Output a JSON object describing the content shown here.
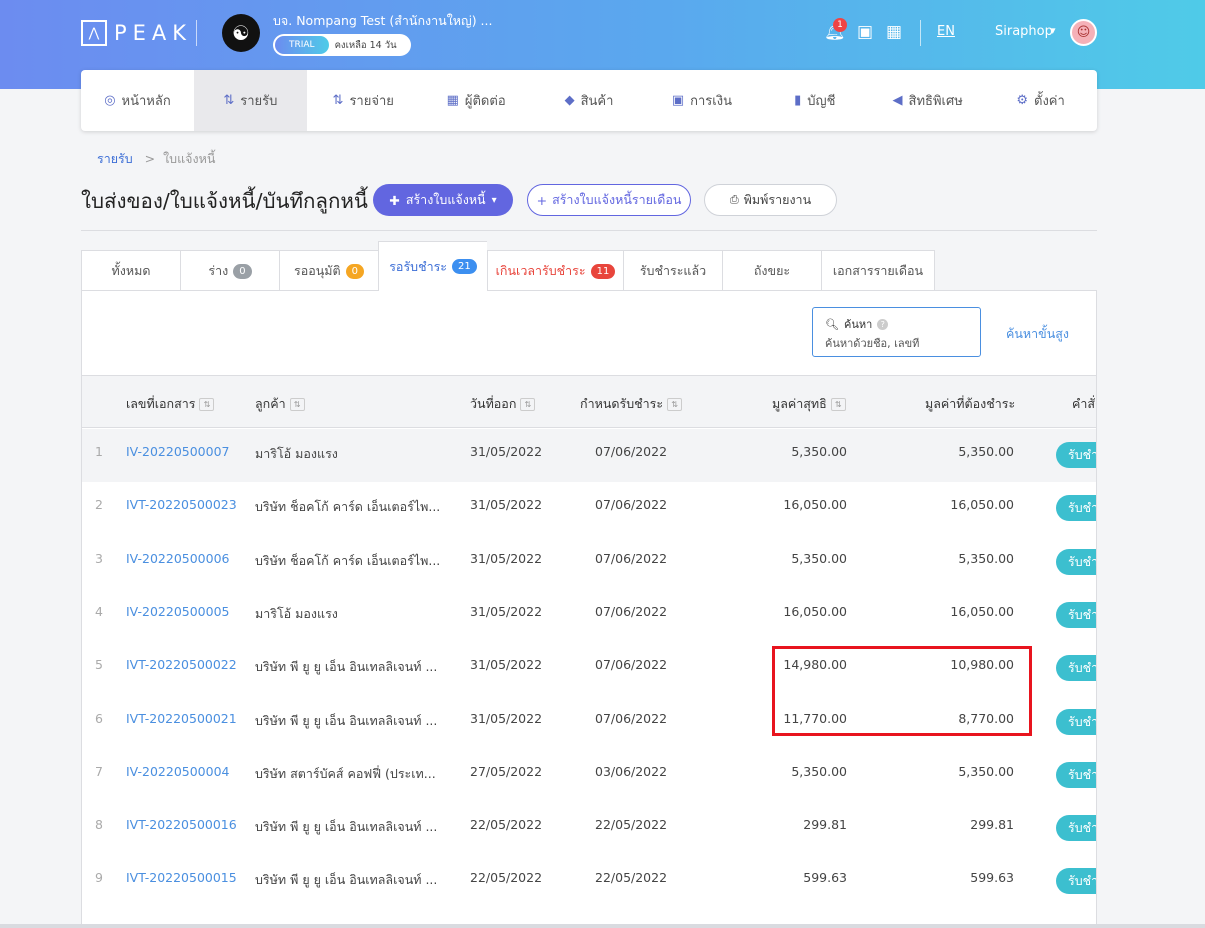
{
  "header": {
    "logo_icon": "⋀",
    "logo_text": "PEAK",
    "company_name": "บจ. Nompang Test (สำนักงานใหญ่) ...",
    "trial_label": "TRIAL",
    "trial_days": "คงเหลือ 14 วัน",
    "notification_count": "1",
    "language": "EN",
    "username": "Siraphop",
    "icons": [
      "bell-icon",
      "book-icon",
      "apps-grid-icon",
      "chevron-down-icon",
      "user-avatar"
    ]
  },
  "nav": {
    "items": [
      {
        "label": "หน้าหลัก",
        "icon": "dashboard-icon",
        "glyph": "◎"
      },
      {
        "label": "รายรับ",
        "icon": "income-icon",
        "glyph": "⇅"
      },
      {
        "label": "รายจ่าย",
        "icon": "expense-icon",
        "glyph": "⇅"
      },
      {
        "label": "ผู้ติดต่อ",
        "icon": "contacts-icon",
        "glyph": "▦"
      },
      {
        "label": "สินค้า",
        "icon": "product-box-icon",
        "glyph": "◆"
      },
      {
        "label": "การเงิน",
        "icon": "money-icon",
        "glyph": "▣"
      },
      {
        "label": "บัญชี",
        "icon": "ledger-book-icon",
        "glyph": "▮"
      },
      {
        "label": "สิทธิพิเศษ",
        "icon": "megaphone-icon",
        "glyph": "◀"
      },
      {
        "label": "ตั้งค่า",
        "icon": "gear-icon",
        "glyph": "⚙"
      }
    ],
    "active_index": 1
  },
  "breadcrumb": {
    "parent": "รายรับ",
    "separator": ">",
    "current": "ใบแจ้งหนี้"
  },
  "page": {
    "title": "ใบส่งของ/ใบแจ้งหนี้/บันทึกลูกหนี้",
    "create_button": "สร้างใบแจ้งหนี้",
    "monthly_button": "สร้างใบแจ้งหนี้รายเดือน",
    "print_button": "พิมพ์รายงาน"
  },
  "tabs": [
    {
      "label": "ทั้งหมด",
      "badge": null
    },
    {
      "label": "ร่าง",
      "badge": "0"
    },
    {
      "label": "รออนุมัติ",
      "badge": "0"
    },
    {
      "label": "รอรับชำระ",
      "badge": "21"
    },
    {
      "label": "เกินเวลารับชำระ",
      "badge": "11"
    },
    {
      "label": "รับชำระแล้ว",
      "badge": null
    },
    {
      "label": "ถังขยะ",
      "badge": null
    },
    {
      "label": "เอกสารรายเดือน",
      "badge": null
    }
  ],
  "search": {
    "label": "ค้นหา",
    "placeholder": "ค้นหาด้วยชื่อ, เลขที่",
    "advanced_link": "ค้นหาขั้นสูง"
  },
  "table": {
    "columns": [
      "เลขที่เอกสาร",
      "ลูกค้า",
      "วันที่ออก",
      "กำหนดรับชำระ",
      "มูลค่าสุทธิ",
      "มูลค่าที่ต้องชำระ",
      "คำสั่ง"
    ],
    "rows": [
      {
        "no": "1",
        "doc": "IV-20220500007",
        "customer": "มาริโอ้ มองแรง",
        "issue": "31/05/2022",
        "due": "07/06/2022",
        "net": "5,350.00",
        "remaining": "5,350.00",
        "action": "รับชำระ"
      },
      {
        "no": "2",
        "doc": "IVT-20220500023",
        "customer": "บริษัท ช็อคโก้ คาร์ด เอ็นเตอร์ไพ...",
        "issue": "31/05/2022",
        "due": "07/06/2022",
        "net": "16,050.00",
        "remaining": "16,050.00",
        "action": "รับชำระ"
      },
      {
        "no": "3",
        "doc": "IV-20220500006",
        "customer": "บริษัท ช็อคโก้ คาร์ด เอ็นเตอร์ไพ...",
        "issue": "31/05/2022",
        "due": "07/06/2022",
        "net": "5,350.00",
        "remaining": "5,350.00",
        "action": "รับชำระ"
      },
      {
        "no": "4",
        "doc": "IV-20220500005",
        "customer": "มาริโอ้ มองแรง",
        "issue": "31/05/2022",
        "due": "07/06/2022",
        "net": "16,050.00",
        "remaining": "16,050.00",
        "action": "รับชำระ"
      },
      {
        "no": "5",
        "doc": "IVT-20220500022",
        "customer": "บริษัท พี ยู ยู เอ็น อินเทลลิเจนท์ ...",
        "issue": "31/05/2022",
        "due": "07/06/2022",
        "net": "14,980.00",
        "remaining": "10,980.00",
        "action": "รับชำระ"
      },
      {
        "no": "6",
        "doc": "IVT-20220500021",
        "customer": "บริษัท พี ยู ยู เอ็น อินเทลลิเจนท์ ...",
        "issue": "31/05/2022",
        "due": "07/06/2022",
        "net": "11,770.00",
        "remaining": "8,770.00",
        "action": "รับชำระ"
      },
      {
        "no": "7",
        "doc": "IV-20220500004",
        "customer": "บริษัท สตาร์บัคส์ คอฟฟี่ (ประเท...",
        "issue": "27/05/2022",
        "due": "03/06/2022",
        "net": "5,350.00",
        "remaining": "5,350.00",
        "action": "รับชำระ"
      },
      {
        "no": "8",
        "doc": "IVT-20220500016",
        "customer": "บริษัท พี ยู ยู เอ็น อินเทลลิเจนท์ ...",
        "issue": "22/05/2022",
        "due": "22/05/2022",
        "net": "299.81",
        "remaining": "299.81",
        "action": "รับชำระ"
      },
      {
        "no": "9",
        "doc": "IVT-20220500015",
        "customer": "บริษัท พี ยู ยู เอ็น อินเทลลิเจนท์ ...",
        "issue": "22/05/2022",
        "due": "22/05/2022",
        "net": "599.63",
        "remaining": "599.63",
        "action": "รับชำระ"
      }
    ]
  },
  "colors": {
    "accent": "#6266e0",
    "link": "#4a8fe0",
    "pay_button": "#3cbfcf",
    "highlight": "#e8141e"
  }
}
